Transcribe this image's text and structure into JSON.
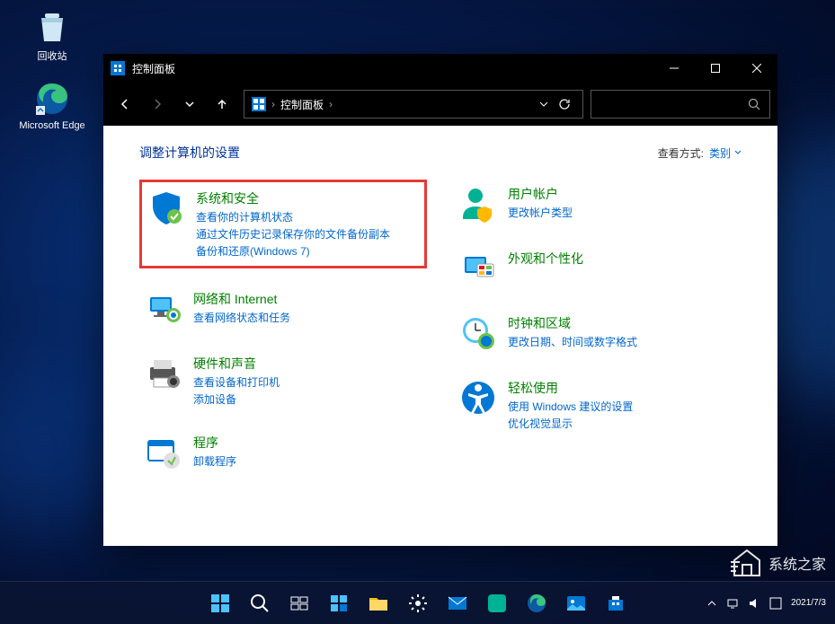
{
  "desktop": {
    "recycle_bin": "回收站",
    "edge": "Microsoft Edge"
  },
  "window": {
    "title": "控制面板",
    "breadcrumb": {
      "root_icon": "control-panel",
      "seg1": "控制面板"
    },
    "content": {
      "heading": "调整计算机的设置",
      "view_label": "查看方式:",
      "view_value": "类别"
    },
    "categories": {
      "system_security": {
        "title": "系统和安全",
        "l1": "查看你的计算机状态",
        "l2": "通过文件历史记录保存你的文件备份副本",
        "l3": "备份和还原(Windows 7)"
      },
      "network": {
        "title": "网络和 Internet",
        "l1": "查看网络状态和任务"
      },
      "hardware": {
        "title": "硬件和声音",
        "l1": "查看设备和打印机",
        "l2": "添加设备"
      },
      "programs": {
        "title": "程序",
        "l1": "卸载程序"
      },
      "user_accounts": {
        "title": "用户帐户",
        "l1": "更改帐户类型"
      },
      "appearance": {
        "title": "外观和个性化"
      },
      "clock_region": {
        "title": "时钟和区域",
        "l1": "更改日期、时间或数字格式"
      },
      "ease_of_access": {
        "title": "轻松使用",
        "l1": "使用 Windows 建议的设置",
        "l2": "优化视觉显示"
      }
    }
  },
  "tray": {
    "datetime": "2021/7/3"
  },
  "watermark": "系统之家"
}
